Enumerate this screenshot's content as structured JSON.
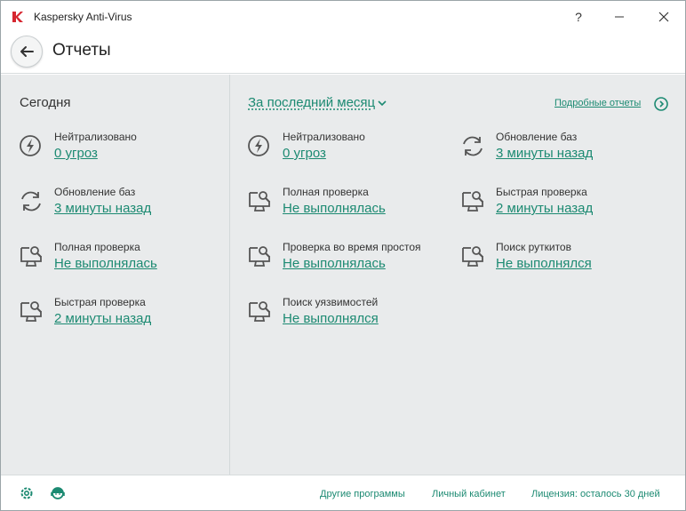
{
  "window": {
    "title": "Kaspersky Anti-Virus",
    "help": "?"
  },
  "header": {
    "title": "Отчеты"
  },
  "today": {
    "title": "Сегодня",
    "items": [
      {
        "icon": "lightning-icon",
        "label": "Нейтрализовано",
        "value": "0 угроз"
      },
      {
        "icon": "refresh-icon",
        "label": "Обновление баз",
        "value": "3 минуты назад"
      },
      {
        "icon": "monitor-scan-icon",
        "label": "Полная проверка",
        "value": "Не выполнялась"
      },
      {
        "icon": "monitor-scan-icon",
        "label": "Быстрая проверка",
        "value": "2 минуты назад"
      }
    ]
  },
  "month": {
    "period_label": "За последний месяц",
    "details_link": "Подробные отчеты",
    "col1": [
      {
        "icon": "lightning-icon",
        "label": "Нейтрализовано",
        "value": "0 угроз"
      },
      {
        "icon": "monitor-scan-icon",
        "label": "Полная проверка",
        "value": "Не выполнялась"
      },
      {
        "icon": "monitor-scan-icon",
        "label": "Проверка во время простоя",
        "value": "Не выполнялась"
      },
      {
        "icon": "monitor-scan-icon",
        "label": "Поиск уязвимостей",
        "value": "Не выполнялся"
      }
    ],
    "col2": [
      {
        "icon": "refresh-icon",
        "label": "Обновление баз",
        "value": "3 минуты назад"
      },
      {
        "icon": "monitor-scan-icon",
        "label": "Быстрая проверка",
        "value": "2 минуты назад"
      },
      {
        "icon": "monitor-scan-icon",
        "label": "Поиск руткитов",
        "value": "Не выполнялся"
      }
    ]
  },
  "footer": {
    "other_programs": "Другие программы",
    "account": "Личный кабинет",
    "license": "Лицензия: осталось 30 дней"
  },
  "colors": {
    "accent": "#1c8a72",
    "background": "#e9ebec",
    "brand_red": "#d6262f"
  }
}
